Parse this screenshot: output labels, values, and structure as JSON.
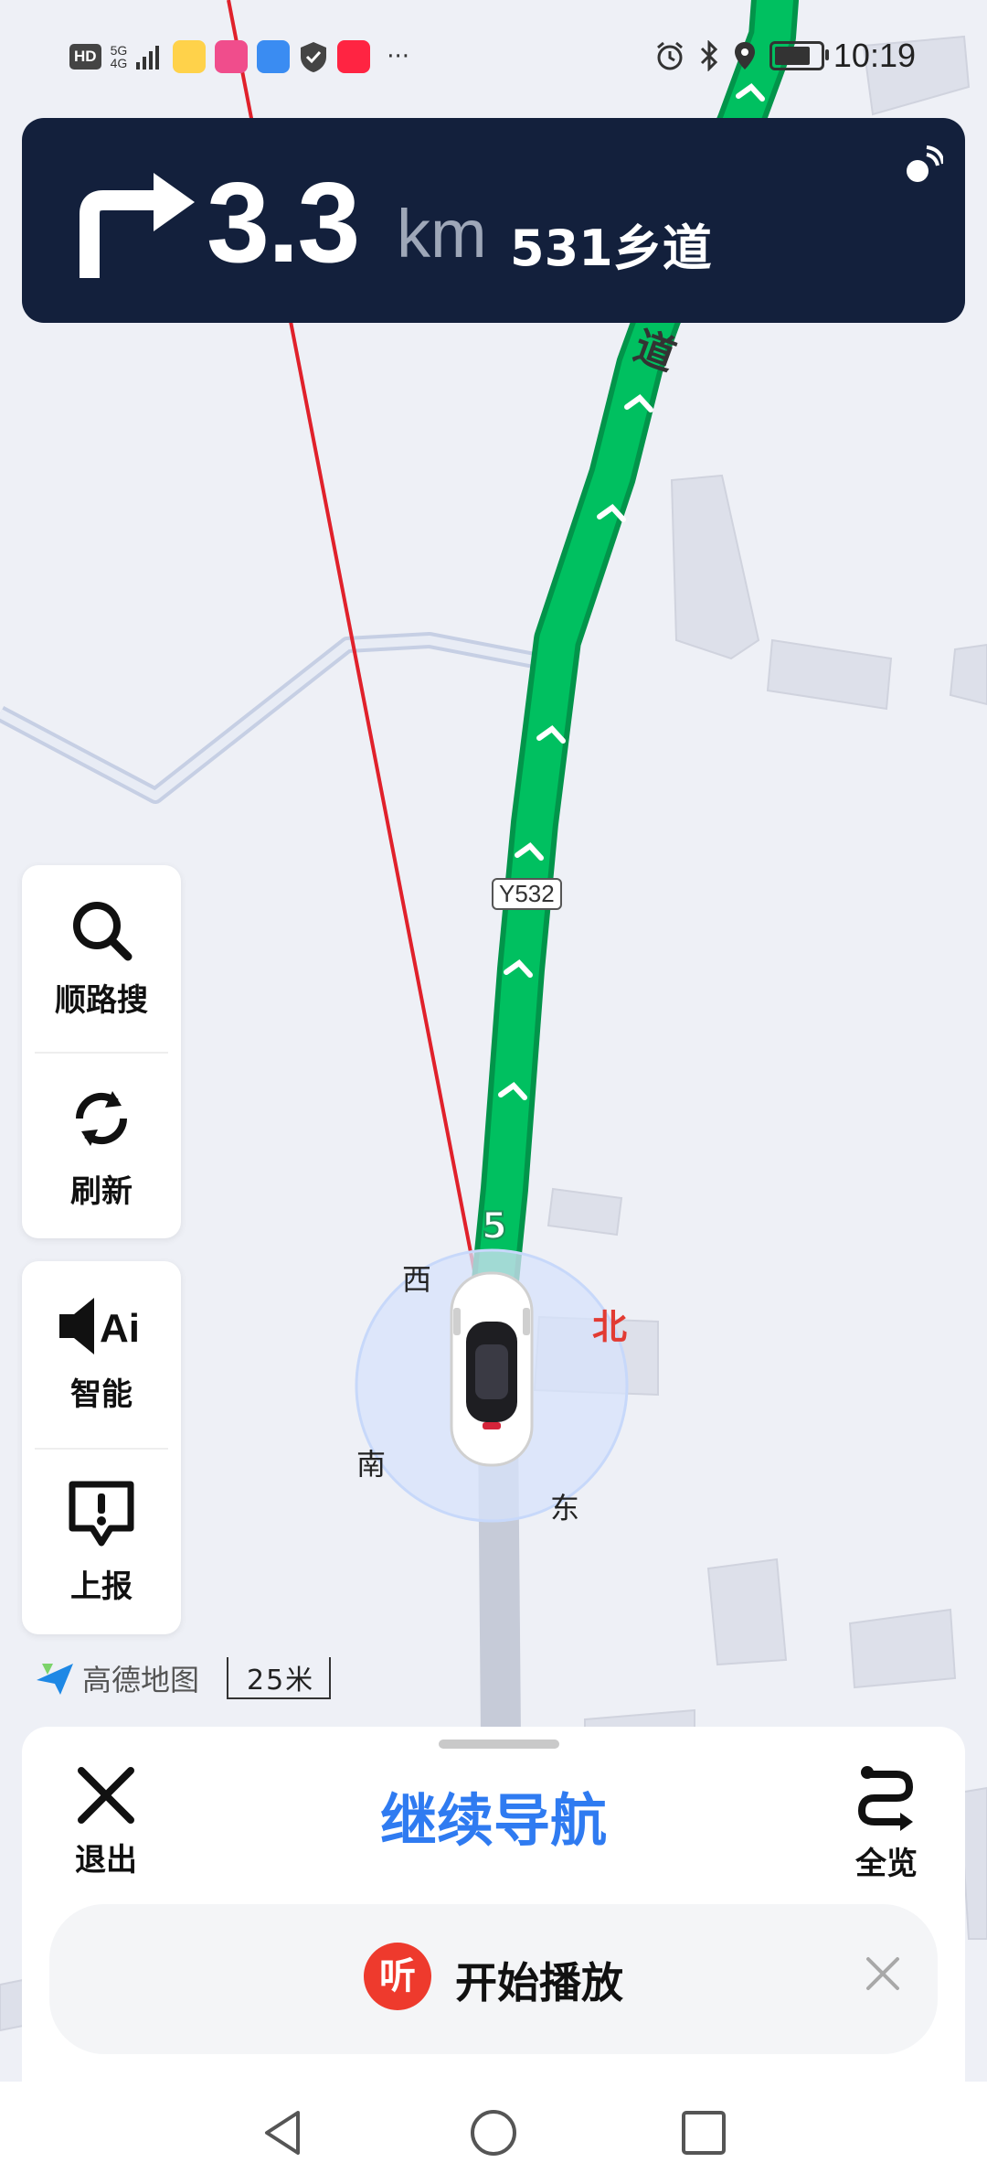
{
  "status_bar": {
    "network_badge": "HD",
    "signal_text": "5G",
    "signal_sub": "4G",
    "time": "10:19",
    "battery_level": 0.7
  },
  "navigation": {
    "distance": "3.3",
    "unit": "km",
    "road": "531乡道",
    "direction_icon": "turn-right-icon",
    "gps_icon": "gps-signal-icon"
  },
  "map": {
    "road_shield": "Y532",
    "road_text_top": "道",
    "road_text_near": "5",
    "compass": {
      "north": "北",
      "south": "南",
      "east": "东",
      "west": "西"
    },
    "logo_text": "高德地图",
    "scale_text": "25米"
  },
  "side_buttons": {
    "search_label": "顺路搜",
    "refresh_label": "刷新",
    "voice_label": "智能",
    "report_label": "上报"
  },
  "bottom_sheet": {
    "exit_label": "退出",
    "continue_label": "继续导航",
    "overview_label": "全览",
    "player_badge": "听",
    "player_text": "开始播放"
  },
  "colors": {
    "nav_card": "#13203c",
    "route": "#00c060",
    "accent": "#2f7bf1",
    "compass_north": "#e23b33"
  }
}
